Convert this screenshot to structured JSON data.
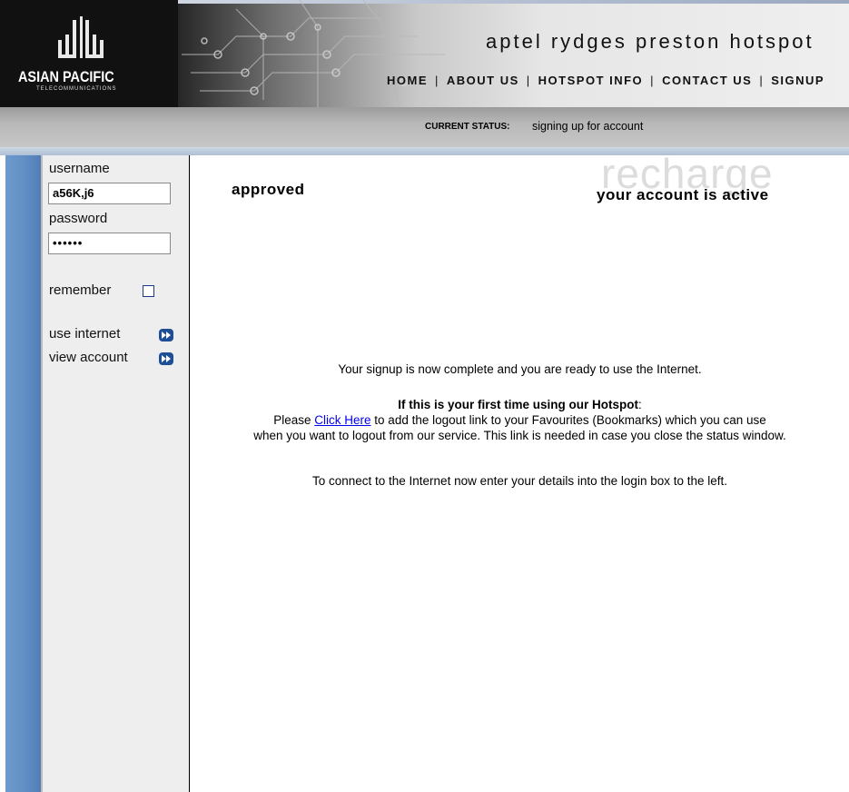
{
  "header": {
    "logo_title": "ASIAN PACIFIC",
    "logo_subtitle": "TELECOMMUNICATIONS",
    "site_title": "aptel rydges preston hotspot",
    "nav": [
      "HOME",
      "ABOUT US",
      "HOTSPOT INFO",
      "CONTACT US",
      "SIGNUP"
    ],
    "nav_separator": "|"
  },
  "status": {
    "label": "CURRENT STATUS:",
    "value": "signing up for account"
  },
  "sidebar": {
    "username_label": "username",
    "username_value": "a56K,j6",
    "password_label": "password",
    "password_value": "••••••",
    "remember_label": "remember",
    "remember_checked": false,
    "links": [
      {
        "label": "use internet",
        "icon": "fast-forward-icon"
      },
      {
        "label": "view account",
        "icon": "fast-forward-icon"
      }
    ]
  },
  "main": {
    "watermark": "recharge",
    "approved": "approved",
    "account_status": "your account is active",
    "complete_msg": "Your signup is now complete and you are ready to use the Internet.",
    "first_time_heading": "If this is your first time using our Hotspot",
    "first_time_colon": ":",
    "please_text": "Please",
    "click_here_link": "Click Here",
    "bookmark_text_1": "to add the logout link to your Favourites (Bookmarks) which you can use",
    "bookmark_text_2": "when you want to logout from our service. This link is needed in case you close the status window.",
    "connect_msg": "To connect to the Internet now enter your details into the login box to the left."
  },
  "colors": {
    "sidebar_blue": "#5f8dc3",
    "link_blue": "#0000ee",
    "arrow_icon_blue": "#1d4e96"
  }
}
